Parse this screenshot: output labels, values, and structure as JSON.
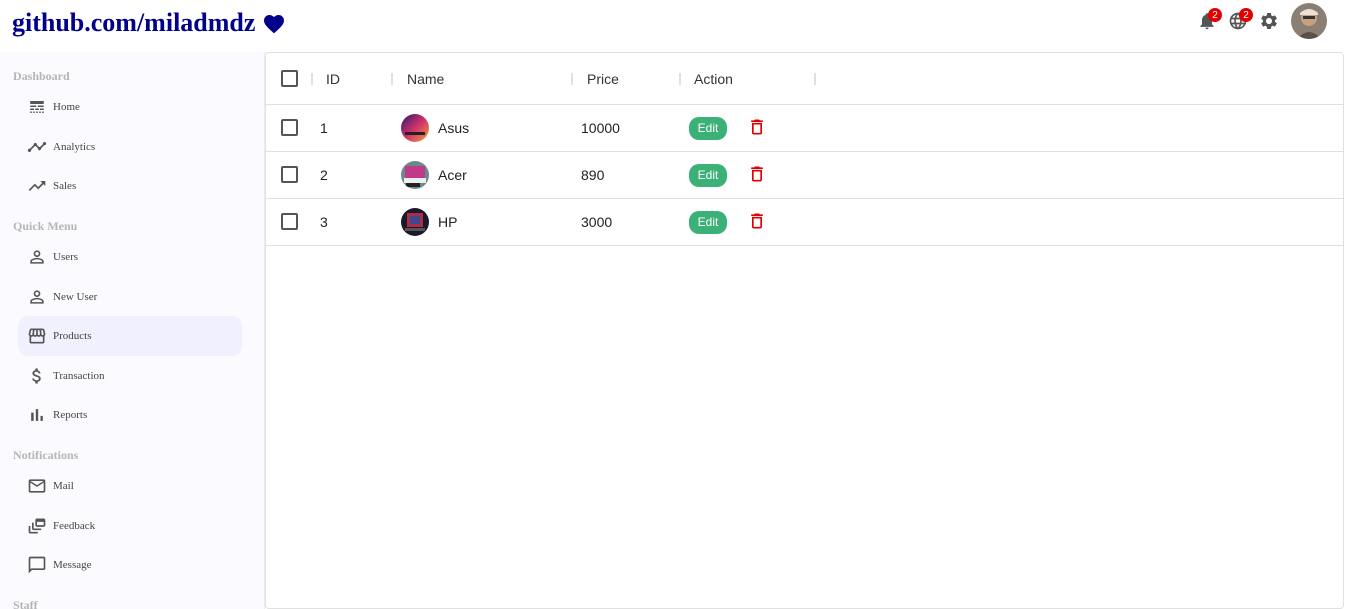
{
  "topbar": {
    "brand": "github.com/miladmdz",
    "brand_color": "#00008b",
    "notifications_badge": "2",
    "language_badge": "2",
    "icons": [
      "heart-icon",
      "bell-icon",
      "globe-icon",
      "gear-icon",
      "avatar"
    ]
  },
  "sidebar": {
    "sections": [
      {
        "title": "Dashboard",
        "items": [
          {
            "label": "Home",
            "icon": "line-style-icon"
          },
          {
            "label": "Analytics",
            "icon": "timeline-icon"
          },
          {
            "label": "Sales",
            "icon": "trending-up-icon"
          }
        ]
      },
      {
        "title": "Quick Menu",
        "items": [
          {
            "label": "Users",
            "icon": "person-icon"
          },
          {
            "label": "New User",
            "icon": "person-icon"
          },
          {
            "label": "Products",
            "icon": "storefront-icon",
            "active": true
          },
          {
            "label": "Transaction",
            "icon": "dollar-icon"
          },
          {
            "label": "Reports",
            "icon": "bar-chart-icon"
          }
        ]
      },
      {
        "title": "Notifications",
        "items": [
          {
            "label": "Mail",
            "icon": "mail-icon"
          },
          {
            "label": "Feedback",
            "icon": "dynamic-feed-icon"
          },
          {
            "label": "Message",
            "icon": "chat-bubble-icon"
          }
        ]
      },
      {
        "title": "Staff",
        "items": []
      }
    ]
  },
  "table": {
    "columns": [
      "ID",
      "Name",
      "Price",
      "Action"
    ],
    "rows": [
      {
        "id": "1",
        "name": "Asus",
        "price": "10000",
        "action": "Edit"
      },
      {
        "id": "2",
        "name": "Acer",
        "price": "890",
        "action": "Edit"
      },
      {
        "id": "3",
        "name": "HP",
        "price": "3000",
        "action": "Edit"
      }
    ]
  },
  "colors": {
    "edit": "#3bb077",
    "delete": "#e00000",
    "active_bg": "#f0f0ff"
  }
}
